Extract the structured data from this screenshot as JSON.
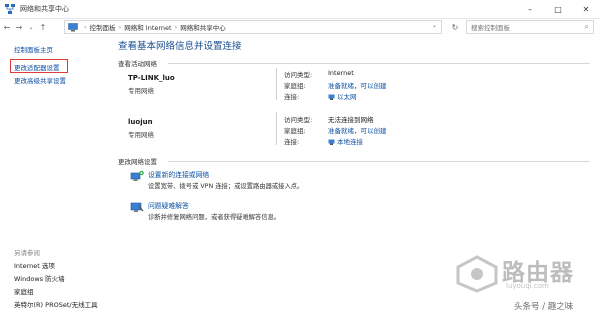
{
  "window": {
    "title": "网络和共享中心",
    "controls": [
      "–",
      "□",
      "✕"
    ]
  },
  "addressbar": {
    "crumbs": [
      "控制面板",
      "网络和 Internet",
      "网络和共享中心"
    ],
    "search_placeholder": "搜索控制面板"
  },
  "sidebar": {
    "links": [
      "控制面板主页",
      "更改适配器设置",
      "更改高级共享设置"
    ],
    "see_also_title": "另请参阅",
    "see_also": [
      "Internet 选项",
      "Windows 防火墙",
      "家庭组",
      "英特尔(R) PROSet/无线工具"
    ]
  },
  "main": {
    "heading": "查看基本网络信息并设置连接",
    "active_networks_title": "查看活动网络",
    "networks": [
      {
        "name": "TP-LINK_luo",
        "type": "专用网络",
        "access_label": "访问类型:",
        "access_value": "Internet",
        "homegroup_label": "家庭组:",
        "homegroup_value": "准备就绪，可以创建",
        "conn_label": "连接:",
        "conn_value": "以太网"
      },
      {
        "name": "luojun",
        "type": "专用网络",
        "access_label": "访问类型:",
        "access_value": "无法连接到网络",
        "homegroup_label": "家庭组:",
        "homegroup_value": "准备就绪，可以创建",
        "conn_label": "连接:",
        "conn_value": "本地连接"
      }
    ],
    "change_settings_title": "更改网络设置",
    "tasks": [
      {
        "link": "设置新的连接或网络",
        "desc": "设置宽带、拨号或 VPN 连接；或设置路由器或接入点。"
      },
      {
        "link": "问题疑难解答",
        "desc": "诊断并修复网络问题，或者获得疑难解答信息。"
      }
    ]
  },
  "watermark": {
    "brand": "路由器",
    "url": "luyouqi.com",
    "author": "头条号 / 趣之味"
  },
  "colors": {
    "link": "#0b4fa3",
    "heading": "#1a4f92",
    "highlight": "#e23b3b"
  }
}
